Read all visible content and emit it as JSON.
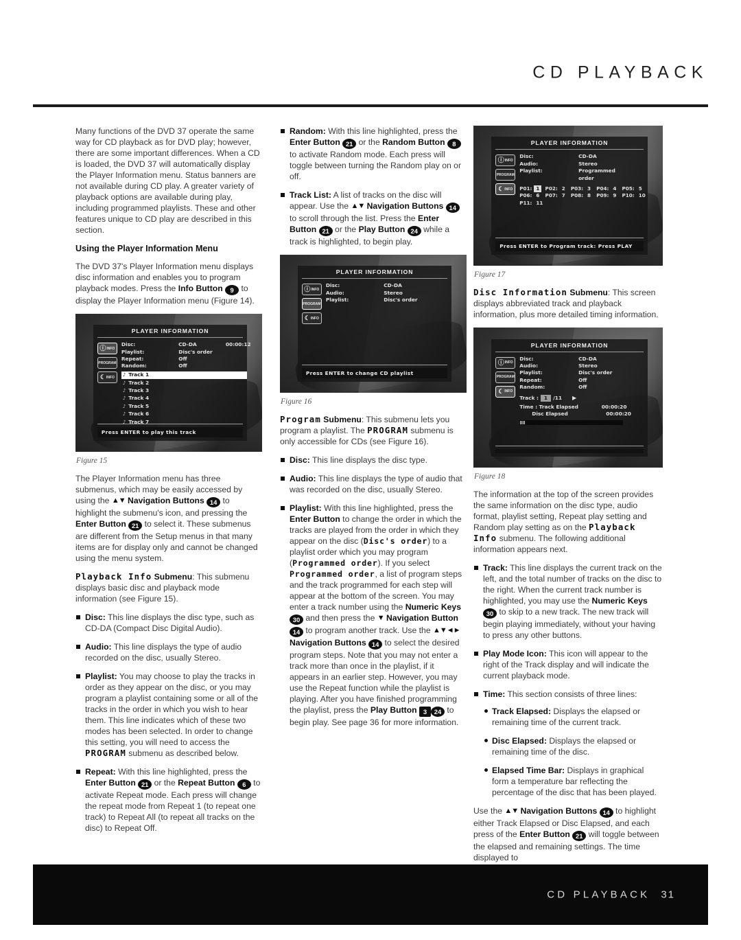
{
  "header": {
    "title": "CD PLAYBACK"
  },
  "footer": {
    "title": "CD PLAYBACK",
    "page": "31"
  },
  "col1": {
    "intro": "Many functions of the DVD 37 operate the same way for CD playback as for DVD play; however, there are some important differences. When a CD is loaded, the DVD 37 will automatically display the Player Information menu. Status banners are not available during CD play. A greater variety of playback options are available during play, including programmed playlists. These and other features unique to CD play are described in this section.",
    "heading_using_menu": "Using the Player Information Menu",
    "para_info_1": "The DVD 37's Player Information menu displays disc information and enables you to program playback modes. Press the ",
    "info_button_label": "Info Button",
    "info_button_num": "9",
    "para_info_2": " to display the Player Information menu (Figure 14).",
    "fig15_caption": "Figure 15",
    "para_submenus_1": "The Player Information menu has three submenus, which may be easily accessed by using the ",
    "nav_buttons_label": "Navigation Buttons",
    "nav_buttons_num": "14",
    "para_submenus_2": " to highlight the submenu's icon, and pressing the ",
    "enter_button_label": "Enter Button",
    "enter_button_num": "21",
    "para_submenus_3": " to select it. These submenus are different from the Setup menus in that many items are for display only and cannot be changed using the menu system.",
    "playback_info_title": "Playback Info",
    "playback_info_sub": " Submenu",
    "playback_info_text": ": This submenu displays basic disc and playback mode information (see Figure 15).",
    "bullet_disc_label": "Disc:",
    "bullet_disc_text": " This line displays the disc type, such as CD-DA (Compact Disc Digital Audio).",
    "bullet_audio_label": "Audio:",
    "bullet_audio_text": " This line displays the type of audio recorded on the disc, usually Stereo.",
    "bullet_playlist_label": "Playlist:",
    "bullet_playlist_text_1": " You may choose to play the tracks in order as they appear on the disc, or you may program a playlist containing some or all of the tracks in the order in which you wish to hear them. This line indicates which of these two modes has been selected. In order to change this setting, you will need to access the ",
    "program_word": "PROGRAM",
    "bullet_playlist_text_2": " submenu as described below.",
    "bullet_repeat_label": "Repeat:",
    "bullet_repeat_t1": " With this line highlighted, press the ",
    "bullet_repeat_enter": "Enter Button",
    "bullet_repeat_enter_num": "21",
    "bullet_repeat_t2": " or the ",
    "bullet_repeat_btn": "Repeat Button",
    "bullet_repeat_btn_num": "6",
    "bullet_repeat_t3": " to activate Repeat mode. Each press will change the repeat mode from Repeat 1 (to repeat one track) to Repeat All (to repeat all tracks on the disc) to Repeat Off."
  },
  "col2": {
    "bullet_random_label": "Random:",
    "bullet_random_t1": " With this line highlighted, press the ",
    "enter_label": "Enter Button",
    "enter_num": "21",
    "bullet_random_t2": " or the ",
    "random_label": "Random Button",
    "random_num": "8",
    "bullet_random_t3": " to activate Random mode. Each press will toggle between turning the Random play on or off.",
    "bullet_tracklist_label": "Track List:",
    "bullet_tracklist_t1": " A list of tracks on the disc will appear. Use the ",
    "nav_label": "Navigation Buttons",
    "nav_num": "14",
    "bullet_tracklist_t2": " to scroll through the list. Press the ",
    "bullet_tracklist_t3": " or the ",
    "play_label": "Play Button",
    "play_num": "24",
    "bullet_tracklist_t4": " while a track is highlighted, to begin play.",
    "fig16_caption": "Figure 16",
    "program_title": "Program",
    "program_sub": " Submenu",
    "program_text_1": ": This submenu lets you program a playlist. The ",
    "program_word": "PROGRAM",
    "program_text_2": " submenu is only accessible for CDs (see Figure 16).",
    "bullet_disc_label": "Disc:",
    "bullet_disc_text": " This line displays the disc type.",
    "bullet_audio_label": "Audio:",
    "bullet_audio_text": " This line displays the type of audio that was recorded on the disc, usually Stereo.",
    "bullet_playlist_label": "Playlist:",
    "bullet_playlist_t1": " With this line highlighted, press the ",
    "button_label": "Button",
    "button_num": "21",
    "bullet_playlist_t2": " to change the order in which the tracks are played from the order in which they appear on the disc (",
    "discs_order": "Disc's order",
    "bullet_playlist_t3": ") to a playlist order which you may program (",
    "programmed_order": "Programmed order",
    "bullet_playlist_t4": "). If you select ",
    "bullet_playlist_t5": ", a list of program steps and the track programmed for each step will appear at the bottom of the screen. You may enter a track number using the ",
    "numeric_keys": "Numeric Keys",
    "numeric_num": "30",
    "bullet_playlist_t6": " and then press the ",
    "nav_button_single": "Navigation Button",
    "nav_button_single_num": "14",
    "bullet_playlist_t7": " to program another track. Use the ",
    "nav_buttons_multi": "Navigation Buttons",
    "nav_buttons_multi_num": "14",
    "bullet_playlist_t8": " to select the desired program steps. Note that you may not enter a track more than once in the playlist, if it appears in an earlier step. However, you may use the Repeat function while the playlist is playing. After you have finished programming the playlist, press the ",
    "play_button": "Play Button",
    "play_num_sq": "3",
    "play_num_circ": "24",
    "bullet_playlist_t9": " to begin play. See page 36 for more information."
  },
  "col3": {
    "fig17_caption": "Figure 17",
    "disc_info_title": "Disc Information",
    "disc_info_sub": " Submenu",
    "disc_info_text": ": This screen displays abbreviated track and playback information, plus more detailed timing information.",
    "fig18_caption": "Figure 18",
    "para_top_1": "The information at the top of the screen provides the same information on the disc type, audio format, playlist setting, Repeat play setting and Random play setting as on the ",
    "playback_info": "Playback Info",
    "para_top_2": " submenu. The following additional information appears next.",
    "bullet_track_label": "Track:",
    "bullet_track_t1": " This line displays the current track on the left, and the total number of tracks on the disc to the right. When the current track number is highlighted, you may use the ",
    "numeric_keys": "Numeric Keys",
    "numeric_num": "30",
    "bullet_track_t2": " to skip to a new track. The new track will begin playing immediately, without your having to press any other buttons.",
    "bullet_playmode_label": "Play Mode Icon:",
    "bullet_playmode_text": " This icon will appear to the right of the Track display and will indicate the current playback mode.",
    "bullet_time_label": "Time:",
    "bullet_time_text": " This section consists of three lines:",
    "sub_track_elapsed_label": "Track Elapsed:",
    "sub_track_elapsed_text": " Displays the elapsed or remaining time of the current track.",
    "sub_disc_elapsed_label": "Disc Elapsed:",
    "sub_disc_elapsed_text": " Displays the elapsed or remaining time of the disc.",
    "sub_time_bar_label": "Elapsed Time Bar:",
    "sub_time_bar_text": " Displays in graphical form a temperature bar reflecting the percentage of the disc that has been played.",
    "para_use_1": "Use the ",
    "nav_label": "Navigation Buttons",
    "nav_num": "14",
    "para_use_2": " to highlight either Track Elapsed or Disc Elapsed, and each press of the ",
    "enter_label": "Enter Button",
    "enter_num": "21",
    "para_use_3": " will toggle between the elapsed and remaining settings. The time displayed to"
  },
  "figures": {
    "osd_title": "PLAYER INFORMATION",
    "icons": {
      "info": "INFO",
      "program": "PROGRAM",
      "disc": "INFO"
    },
    "fig15": {
      "rows": [
        {
          "key": "Disc:",
          "val": "CD-DA",
          "time": "00:00:12"
        },
        {
          "key": "Playlist:",
          "val": "Disc's order",
          "time": ""
        },
        {
          "key": "Repeat:",
          "val": "Off",
          "time": ""
        },
        {
          "key": "Random:",
          "val": "Off",
          "time": ""
        }
      ],
      "tracks": [
        "Track 1",
        "Track 2",
        "Track 3",
        "Track 4",
        "Track 5",
        "Track 6",
        "Track 7"
      ],
      "highlighted_track": 0,
      "footer": "Press ENTER to play this track"
    },
    "fig16": {
      "rows": [
        {
          "key": "Disc:",
          "val": "CD-DA"
        },
        {
          "key": "Audio:",
          "val": "Stereo"
        },
        {
          "key": "Playlist:",
          "val": "Disc's order"
        }
      ],
      "footer": "Press ENTER to change CD playlist"
    },
    "fig17": {
      "rows": [
        {
          "key": "Disc:",
          "val": "CD-DA"
        },
        {
          "key": "Audio:",
          "val": "Stereo"
        },
        {
          "key": "Playlist:",
          "val": "Programmed order"
        }
      ],
      "program_steps": [
        {
          "step": "P01:",
          "track": "1",
          "hl": true
        },
        {
          "step": "P02:",
          "track": "2",
          "hl": false
        },
        {
          "step": "P03:",
          "track": "3",
          "hl": false
        },
        {
          "step": "P04:",
          "track": "4",
          "hl": false
        },
        {
          "step": "P05:",
          "track": "5",
          "hl": false
        },
        {
          "step": "P06:",
          "track": "6",
          "hl": false
        },
        {
          "step": "P07:",
          "track": "7",
          "hl": false
        },
        {
          "step": "P08:",
          "track": "8",
          "hl": false
        },
        {
          "step": "P09:",
          "track": "9",
          "hl": false
        },
        {
          "step": "P10:",
          "track": "10",
          "hl": false
        },
        {
          "step": "P11:",
          "track": "11",
          "hl": false
        }
      ],
      "footer": "Press ENTER to Program track: Press PLAY"
    },
    "fig18": {
      "rows": [
        {
          "key": "Disc:",
          "val": "CD-DA"
        },
        {
          "key": "Audio:",
          "val": "Stereo"
        },
        {
          "key": "Playlist:",
          "val": "Disc's order"
        },
        {
          "key": "Repeat:",
          "val": "Off"
        },
        {
          "key": "Random:",
          "val": "Off"
        }
      ],
      "track_label": "Track :",
      "track_current": "1",
      "track_total": "/11",
      "play_icon": "▶",
      "time_label": "Time :",
      "time_rows": [
        {
          "lab": "Track Elapsed",
          "val": "00:00:20"
        },
        {
          "lab": "Disc Elapsed",
          "val": "00:00:20"
        }
      ],
      "footer": ""
    }
  }
}
